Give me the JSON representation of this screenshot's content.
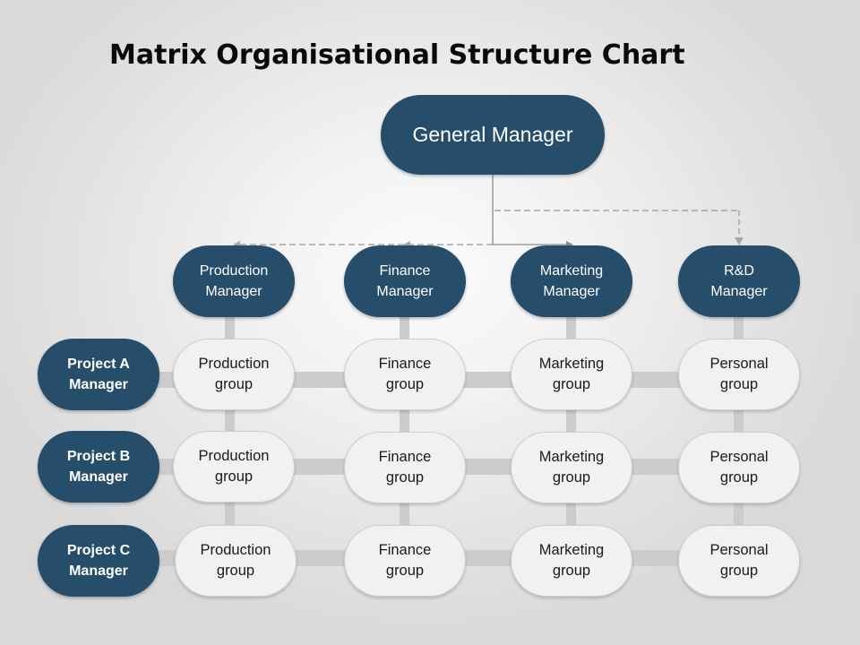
{
  "title": "Matrix Organisational Structure Chart",
  "colors": {
    "node_dark": "#264d6a",
    "node_light": "#f1f1ef",
    "grid_bar": "#cccccc",
    "connector": "#8c8c8c"
  },
  "general_manager": {
    "line1": "General Manager"
  },
  "functional_managers": [
    {
      "line1": "Production",
      "line2": "Manager"
    },
    {
      "line1": "Finance",
      "line2": "Manager"
    },
    {
      "line1": "Marketing",
      "line2": "Manager"
    },
    {
      "line1": "R&D",
      "line2": "Manager"
    }
  ],
  "project_managers": [
    {
      "line1": "Project A",
      "line2": "Manager"
    },
    {
      "line1": "Project B",
      "line2": "Manager"
    },
    {
      "line1": "Project C",
      "line2": "Manager"
    }
  ],
  "groups": [
    [
      {
        "line1": "Production",
        "line2": "group"
      },
      {
        "line1": "Finance",
        "line2": "group"
      },
      {
        "line1": "Marketing",
        "line2": "group"
      },
      {
        "line1": "Personal",
        "line2": "group"
      }
    ],
    [
      {
        "line1": "Production",
        "line2": "group"
      },
      {
        "line1": "Finance",
        "line2": "group"
      },
      {
        "line1": "Marketing",
        "line2": "group"
      },
      {
        "line1": "Personal",
        "line2": "group"
      }
    ],
    [
      {
        "line1": "Production",
        "line2": "group"
      },
      {
        "line1": "Finance",
        "line2": "group"
      },
      {
        "line1": "Marketing",
        "line2": "group"
      },
      {
        "line1": "Personal",
        "line2": "group"
      }
    ]
  ]
}
